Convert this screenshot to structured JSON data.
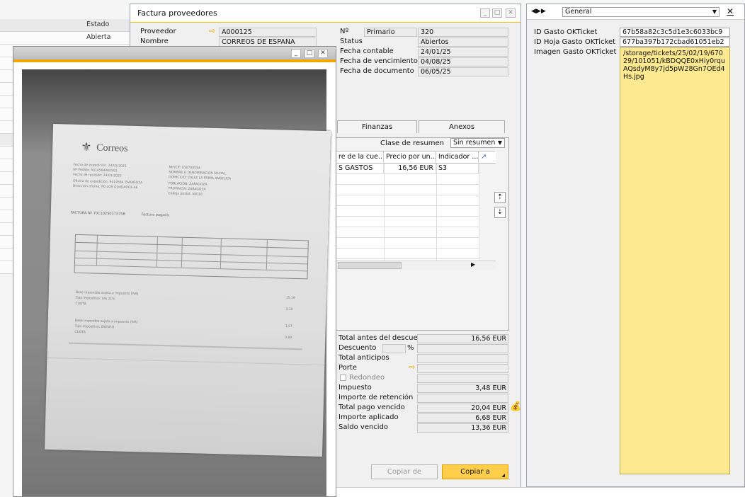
{
  "background_list": {
    "header": "Estado",
    "value": "Abierta"
  },
  "invoice": {
    "window_title": "Factura proveedores",
    "fields_left": [
      {
        "label": "Proveedor",
        "value": "A000125"
      },
      {
        "label": "Nombre",
        "value": "CORREOS DE ESPAÑA"
      }
    ],
    "numero_label": "Nº",
    "series_value": "Primario",
    "numero_value": "320",
    "fields_right": [
      {
        "label": "Status",
        "value": "Abiertos"
      },
      {
        "label": "Fecha contable",
        "value": "24/01/25"
      },
      {
        "label": "Fecha de vencimiento",
        "value": "04/08/25"
      },
      {
        "label": "Fecha de documento",
        "value": "06/05/25"
      }
    ],
    "tabs": [
      "Finanzas",
      "Anexos"
    ],
    "summary_class_label": "Clase de resumen",
    "summary_class_value": "Sin resumen",
    "grid_headers": [
      "re de la cue...",
      "Precio por un...",
      "Indicador ..."
    ],
    "grid_rows": [
      [
        "S GASTOS",
        "16,56 EUR",
        "S3"
      ]
    ],
    "totals": [
      {
        "label": "Total antes del descuento",
        "value": "16,56 EUR"
      },
      {
        "label": "Descuento",
        "value": ""
      },
      {
        "label": "Total anticipos",
        "value": ""
      },
      {
        "label": "Porte",
        "value": ""
      },
      {
        "label": "Redondeo",
        "value": ""
      },
      {
        "label": "Impuesto",
        "value": "3,48 EUR"
      },
      {
        "label": "Importe de retención",
        "value": ""
      },
      {
        "label": "Total pago vencido",
        "value": "20,04 EUR"
      },
      {
        "label": "Importe aplicado",
        "value": "6,68 EUR"
      },
      {
        "label": "Saldo vencido",
        "value": "13,36 EUR"
      }
    ],
    "percent_sign": "%",
    "copy_from_label": "Copiar de",
    "copy_to_label": "Copiar a"
  },
  "receipt": {
    "brand": "Correos",
    "invoice_line": "FACTURA Nº 70C1025017375B",
    "status_line": "Factura pagada"
  },
  "udf_panel": {
    "category_value": "General",
    "fields": [
      {
        "label": "ID Gasto OKTicket",
        "value": "67b58a82c3c5d1e3c6033bc9"
      },
      {
        "label": "ID Hoja Gasto OKTicket",
        "value": "677ba397b172cbad61051eb2"
      },
      {
        "label": "Imagen Gasto OKTicket",
        "value": "/storage/tickets/25/02/19/67029/101051/kBDQQE0xHiy0rquAQsdyM8y7jd5pW28Gn7OEd4Hs.jpg"
      }
    ]
  },
  "colors": {
    "accent": "#ffc000",
    "highlight_field": "#fde98f",
    "copy_to_button": "#ffce4a"
  }
}
